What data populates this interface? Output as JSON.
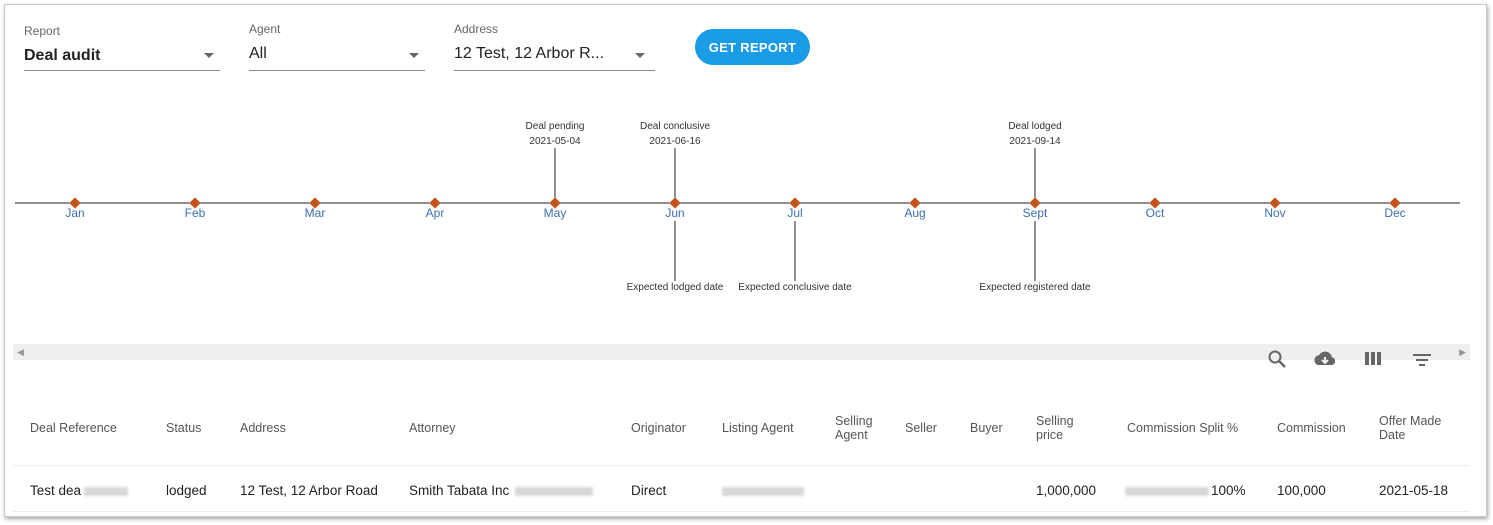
{
  "filters": {
    "report": {
      "label": "Report",
      "value": "Deal audit"
    },
    "agent": {
      "label": "Agent",
      "value": "All"
    },
    "address": {
      "label": "Address",
      "value": "12 Test, 12 Arbor R..."
    },
    "button_label": "GET REPORT"
  },
  "timeline": {
    "months": [
      "Jan",
      "Feb",
      "Mar",
      "Apr",
      "May",
      "Jun",
      "Jul",
      "Aug",
      "Sept",
      "Oct",
      "Nov",
      "Dec"
    ],
    "events_above": [
      {
        "month_index": 4,
        "title": "Deal pending",
        "date": "2021-05-04"
      },
      {
        "month_index": 5,
        "title": "Deal conclusive",
        "date": "2021-06-16"
      },
      {
        "month_index": 8,
        "title": "Deal lodged",
        "date": "2021-09-14"
      }
    ],
    "events_below": [
      {
        "month_index": 5,
        "title": "Expected lodged date"
      },
      {
        "month_index": 6,
        "title": "Expected conclusive date"
      },
      {
        "month_index": 8,
        "title": "Expected registered date"
      }
    ],
    "colors": {
      "marker": "#c0561d",
      "month_label": "#3d6fb0",
      "line": "#222222"
    }
  },
  "toolbar": {
    "icons": [
      "search-icon",
      "download-icon",
      "columns-icon",
      "filter-icon"
    ]
  },
  "table": {
    "headers": {
      "deal_reference": "Deal Reference",
      "status": "Status",
      "address": "Address",
      "attorney": "Attorney",
      "originator": "Originator",
      "listing_agent": "Listing Agent",
      "selling_agent": "Selling Agent",
      "seller": "Seller",
      "buyer": "Buyer",
      "selling_price": "Selling price",
      "commission_split": "Commission Split %",
      "commission": "Commission",
      "offer_made_date": "Offer Made Date"
    },
    "row": {
      "deal_reference": "Test dea",
      "status": "lodged",
      "address": "12 Test, 12 Arbor Road",
      "attorney": "Smith Tabata Inc",
      "originator": "Direct",
      "selling_price": "1,000,000",
      "commission_split": "100%",
      "commission": "100,000",
      "offer_made_date": "2021-05-18"
    }
  }
}
